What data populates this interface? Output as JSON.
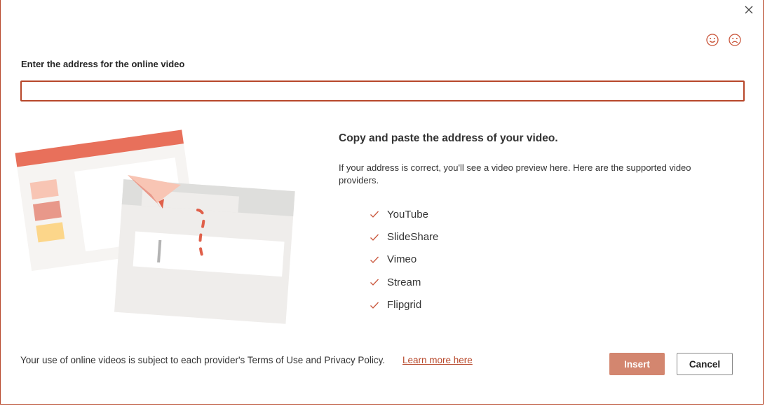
{
  "dialog": {
    "close_icon": "close-icon",
    "feedback": {
      "happy_icon": "smiley-happy-icon",
      "sad_icon": "smiley-sad-icon"
    },
    "address": {
      "label": "Enter the address for the online video",
      "value": "",
      "placeholder": ""
    },
    "info": {
      "heading": "Copy and paste the address of your video.",
      "description": "If your address is correct, you'll see a video preview here. Here are the supported video providers.",
      "providers": [
        "YouTube",
        "SlideShare",
        "Vimeo",
        "Stream",
        "Flipgrid"
      ]
    },
    "footer": {
      "terms": "Your use of online videos is subject to each provider's Terms of Use and Privacy Policy.",
      "learn_more": "Learn more here",
      "insert_label": "Insert",
      "cancel_label": "Cancel"
    },
    "colors": {
      "accent": "#b7472a",
      "insert_button": "#d3866f",
      "check": "#c9553a"
    }
  }
}
